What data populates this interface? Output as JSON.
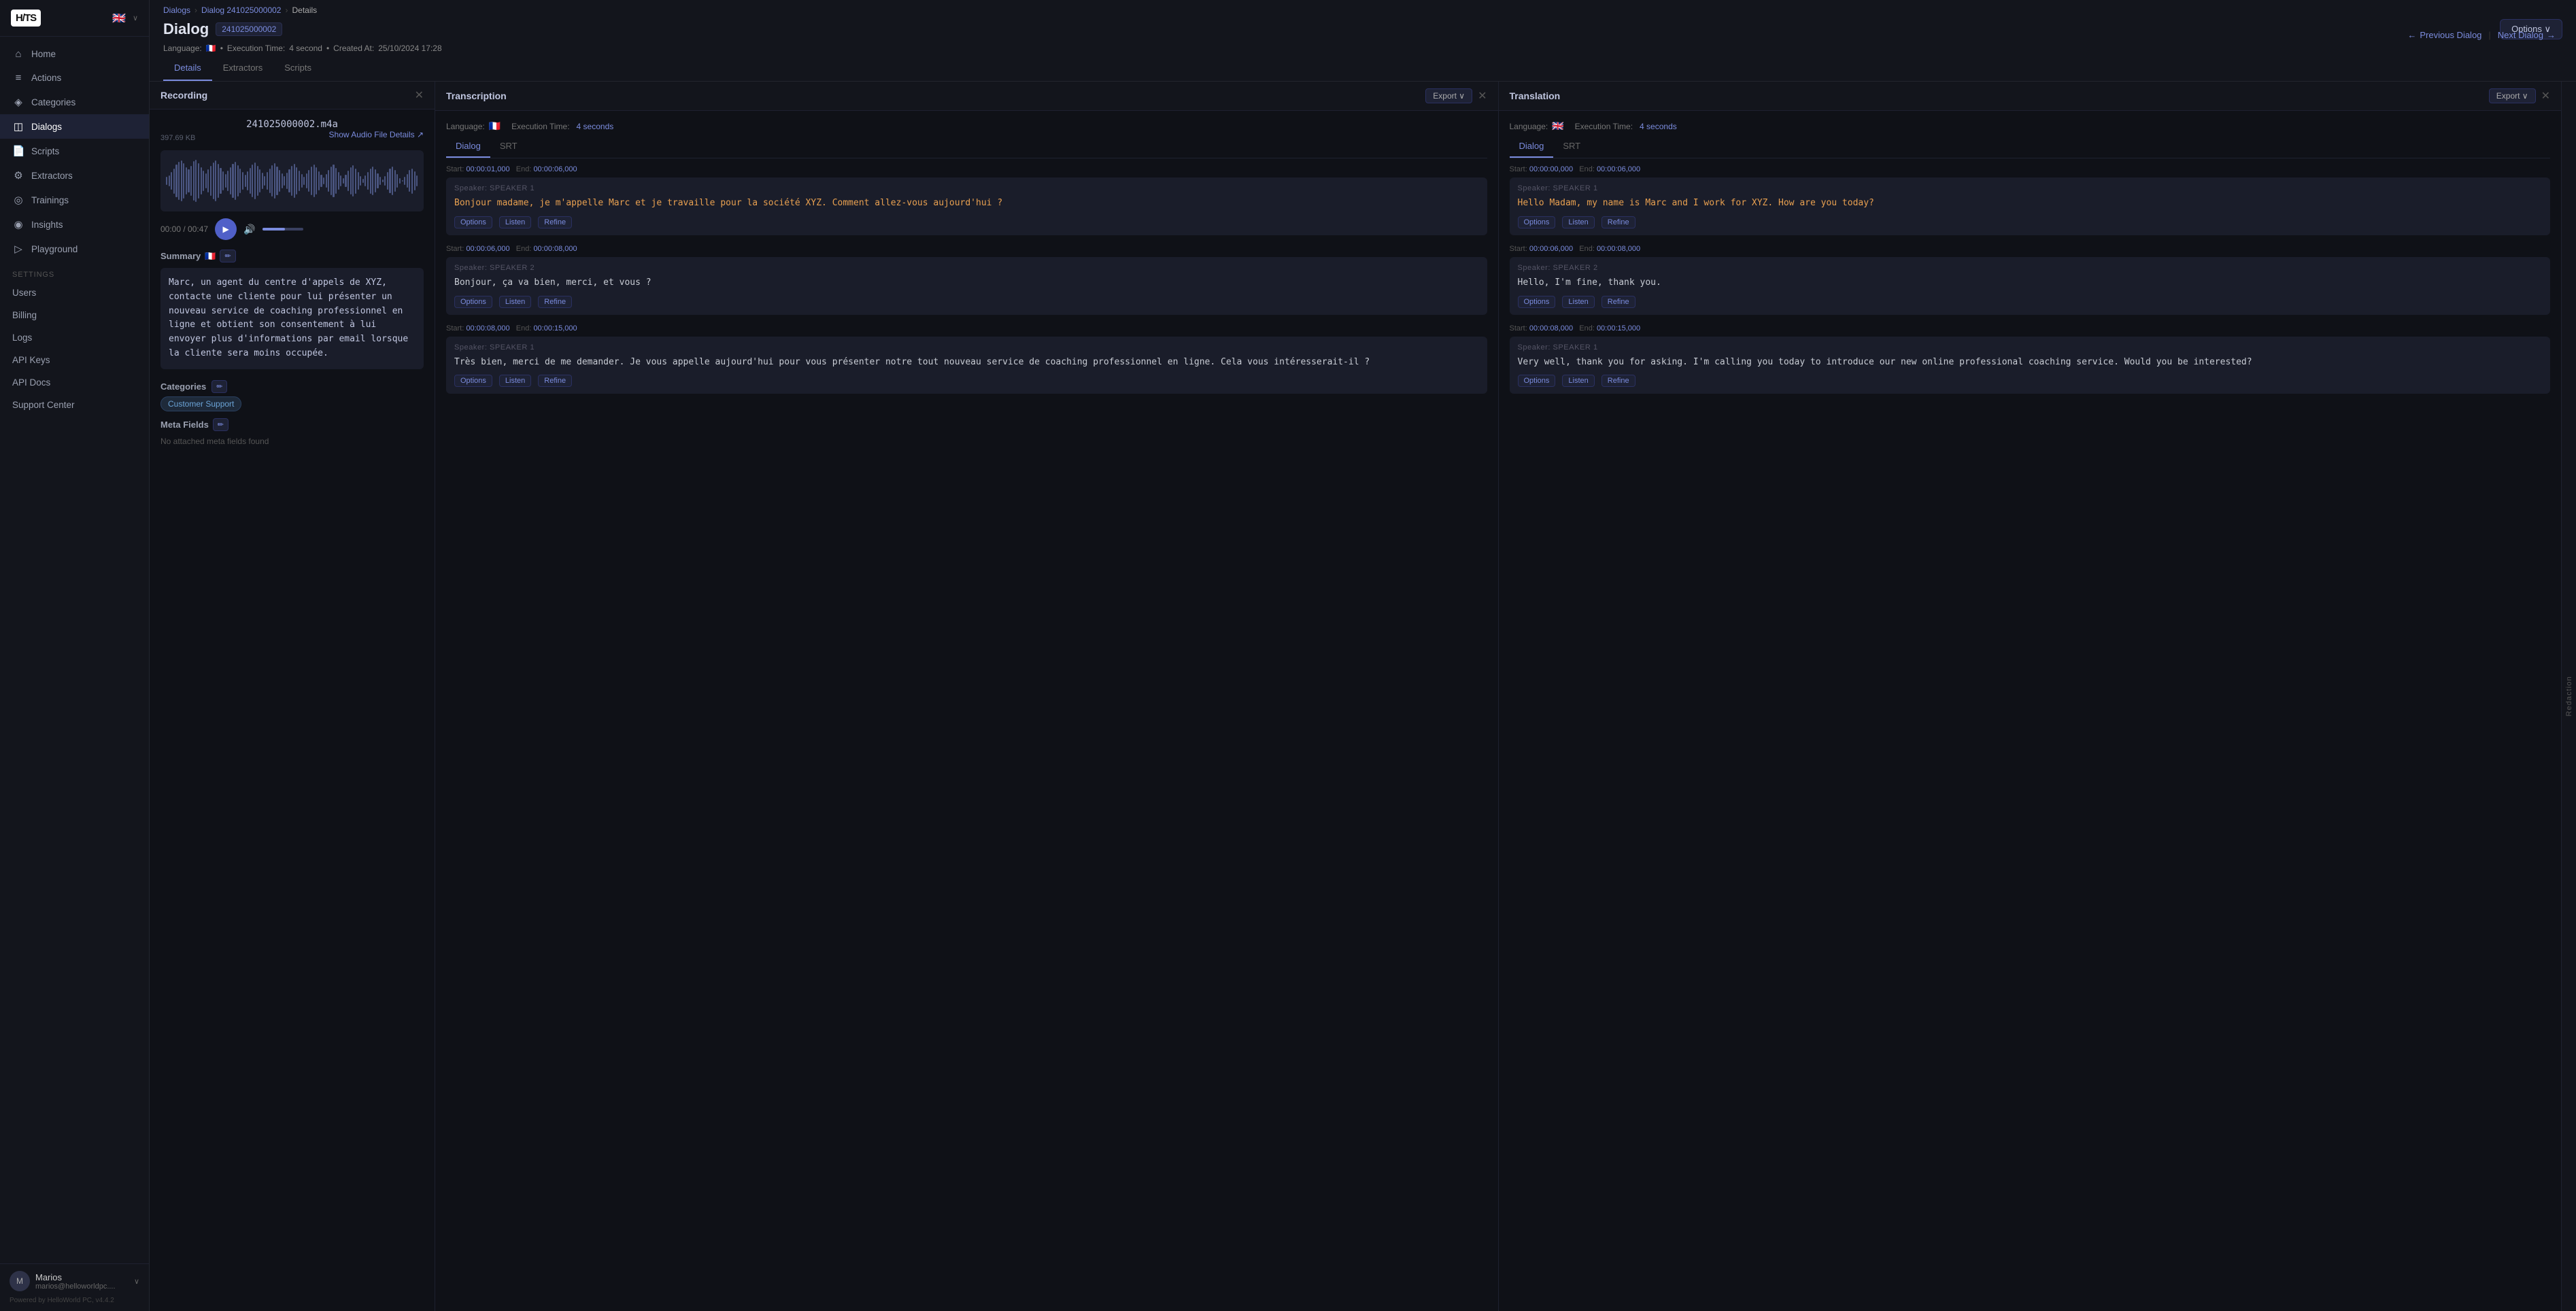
{
  "sidebar": {
    "logo": "H/TS",
    "nav_items": [
      {
        "id": "home",
        "label": "Home",
        "icon": "⌂",
        "active": false
      },
      {
        "id": "actions",
        "label": "Actions",
        "icon": "≡",
        "active": false
      },
      {
        "id": "categories",
        "label": "Categories",
        "icon": "◈",
        "active": false
      },
      {
        "id": "dialogs",
        "label": "Dialogs",
        "icon": "◫",
        "active": true
      },
      {
        "id": "scripts",
        "label": "Scripts",
        "icon": "📄",
        "active": false
      },
      {
        "id": "extractors",
        "label": "Extractors",
        "icon": "⚙",
        "active": false
      },
      {
        "id": "trainings",
        "label": "Trainings",
        "icon": "◎",
        "active": false
      },
      {
        "id": "insights",
        "label": "Insights",
        "icon": "◉",
        "active": false
      },
      {
        "id": "playground",
        "label": "Playground",
        "icon": "▷",
        "active": false
      }
    ],
    "section_label": "Settings",
    "settings_items": [
      {
        "id": "users",
        "label": "Users"
      },
      {
        "id": "billing",
        "label": "Billing"
      },
      {
        "id": "logs",
        "label": "Logs"
      },
      {
        "id": "api-keys",
        "label": "API Keys"
      },
      {
        "id": "api-docs",
        "label": "API Docs"
      },
      {
        "id": "support",
        "label": "Support Center"
      }
    ],
    "user": {
      "name": "Marios",
      "email": "marios@helloworldpc....",
      "powered_by": "Powered by HelloWorld PC, v4.4.2"
    }
  },
  "breadcrumb": {
    "dialogs": "Dialogs",
    "dialog_id": "Dialog 241025000002",
    "current": "Details"
  },
  "header": {
    "title": "Dialog",
    "badge": "241025000002",
    "language_flag": "🇫🇷",
    "execution_time": "4 second",
    "created_at": "25/10/2024 17:28",
    "options_label": "Options ∨"
  },
  "tabs": [
    {
      "id": "details",
      "label": "Details",
      "active": true
    },
    {
      "id": "extractors",
      "label": "Extractors",
      "active": false
    },
    {
      "id": "scripts",
      "label": "Scripts",
      "active": false
    }
  ],
  "navigation": {
    "prev_label": "Previous Dialog",
    "next_label": "Next Dialog"
  },
  "recording_panel": {
    "title": "Recording",
    "filename": "241025000002.m4a",
    "filesize": "397.69 KB",
    "show_audio": "Show Audio File Details ↗",
    "time_display": "00:00 / 00:47",
    "summary_label": "Summary",
    "summary_flag": "🇫🇷",
    "summary_text": "Marc, un agent du centre d'appels de XYZ, contacte une cliente pour lui présenter un nouveau service de coaching professionnel en ligne et obtient son consentement à lui envoyer plus d'informations par email lorsque la cliente sera moins occupée.",
    "categories_label": "Categories",
    "category": "Customer Support",
    "meta_fields_label": "Meta Fields",
    "no_meta": "No attached meta fields found"
  },
  "transcription_panel": {
    "title": "Transcription",
    "export_label": "Export ∨",
    "lang_flag": "🇫🇷",
    "lang_label": "Language:",
    "exec_label": "Execution Time:",
    "exec_time": "4 seconds",
    "tabs": [
      {
        "id": "dialog",
        "label": "Dialog",
        "active": true
      },
      {
        "id": "srt",
        "label": "SRT",
        "active": false
      }
    ],
    "segments": [
      {
        "start": "00:00:01,000",
        "end": "00:00:06,000",
        "speaker": "Speaker: SPEAKER 1",
        "text": "Bonjour madame, je m'appelle Marc et je travaille pour la société XYZ. Comment allez-vous aujourd'hui ?",
        "orange": true
      },
      {
        "start": "00:00:06,000",
        "end": "00:00:08,000",
        "speaker": "Speaker: SPEAKER 2",
        "text": "Bonjour, ça va bien, merci, et vous ?",
        "orange": false
      },
      {
        "start": "00:00:08,000",
        "end": "00:00:15,000",
        "speaker": "Speaker: SPEAKER 1",
        "text": "Très bien, merci de me demander. Je vous appelle aujourd'hui pour vous présenter notre tout nouveau service de coaching professionnel en ligne. Cela vous intéresserait-il ?",
        "orange": false
      }
    ]
  },
  "translation_panel": {
    "title": "Translation",
    "export_label": "Export ∨",
    "lang_flag": "🇬🇧",
    "lang_label": "Language:",
    "exec_label": "Execution Time:",
    "exec_time": "4 seconds",
    "tabs": [
      {
        "id": "dialog",
        "label": "Dialog",
        "active": true
      },
      {
        "id": "srt",
        "label": "SRT",
        "active": false
      }
    ],
    "segments": [
      {
        "start": "00:00:00,000",
        "end": "00:00:06,000",
        "speaker": "Speaker: SPEAKER 1",
        "text": "Hello Madam, my name is Marc and I work for XYZ. How are you today?",
        "orange": true
      },
      {
        "start": "00:00:06,000",
        "end": "00:00:08,000",
        "speaker": "Speaker: SPEAKER 2",
        "text": "Hello, I'm fine, thank you.",
        "orange": false
      },
      {
        "start": "00:00:08,000",
        "end": "00:00:15,000",
        "speaker": "Speaker: SPEAKER 1",
        "text": "Very well, thank you for asking. I'm calling you today to introduce our new online professional coaching service. Would you be interested?",
        "orange": false
      }
    ]
  },
  "side_collapse_label": "Redaction"
}
